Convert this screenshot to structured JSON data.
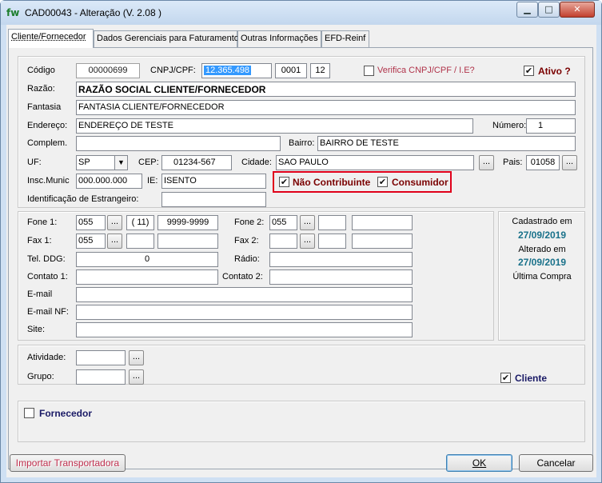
{
  "window": {
    "title": "CAD00043 - Alteração  (V.  2.08 )",
    "icon_text": "fw",
    "min_glyph": "▁",
    "max_glyph": "□",
    "close_glyph": "✕"
  },
  "tabs": [
    {
      "label": "Cliente/Fornecedor"
    },
    {
      "label": "Dados Gerenciais para Faturamento"
    },
    {
      "label": "Outras Informações"
    },
    {
      "label": "EFD-Reinf"
    }
  ],
  "ident": {
    "codigo_label": "Código",
    "codigo_value": "00000699",
    "cnpj_label": "CNPJ/CPF:",
    "cnpj_value": "12.365.498",
    "cnpj_suffix1": "0001",
    "cnpj_suffix2": "12",
    "verifica_label": "Verifica CNPJ/CPF / I.E?",
    "ativo_label": "Ativo ?",
    "razao_label": "Razão:",
    "razao_value": "RAZÃO SOCIAL CLIENTE/FORNECEDOR",
    "fantasia_label": "Fantasia",
    "fantasia_value": "FANTASIA CLIENTE/FORNECEDOR",
    "endereco_label": "Endereço:",
    "endereco_value": "ENDEREÇO DE TESTE",
    "numero_label": "Número:",
    "numero_value": "1",
    "complem_label": "Complem.",
    "complem_value": "",
    "bairro_label": "Bairro:",
    "bairro_value": "BAIRRO DE TESTE",
    "uf_label": "UF:",
    "uf_value": "SP",
    "cep_label": "CEP:",
    "cep_value": "01234-567",
    "cidade_label": "Cidade:",
    "cidade_value": "SAO PAULO",
    "pais_label": "Pais:",
    "pais_value": "01058",
    "insc_label": "Insc.Munic",
    "insc_value": "000.000.000",
    "ie_label": "IE:",
    "ie_value": "ISENTO",
    "nao_contrib_label": "Não Contribuinte",
    "consumidor_label": "Consumidor",
    "estrangeiro_label": "Identificação de Estrangeiro:",
    "estrangeiro_value": ""
  },
  "contact": {
    "fone1_label": "Fone 1:",
    "fone1_ddi": "055",
    "fone1_ddd": "( 11)",
    "fone1_num": "9999-9999",
    "fone2_label": "Fone 2:",
    "fone2_ddi": "055",
    "fax1_label": "Fax 1:",
    "fax1_ddi": "055",
    "fax2_label": "Fax 2:",
    "tel_ddg_label": "Tel. DDG:",
    "tel_ddg_value": "0",
    "radio_label": "Rádio:",
    "contato1_label": "Contato 1:",
    "contato2_label": "Contato 2:",
    "email_label": "E-mail",
    "emailnf_label": "E-mail NF:",
    "site_label": "Site:",
    "dots": "..."
  },
  "status": {
    "cadastrado_label": "Cadastrado em",
    "cadastrado_date": "27/09/2019",
    "alterado_label": "Alterado em",
    "alterado_date": "27/09/2019",
    "ultima_compra_label": "Última Compra"
  },
  "classif": {
    "atividade_label": "Atividade:",
    "grupo_label": "Grupo:",
    "cliente_label": "Cliente"
  },
  "fornecedor": {
    "label": "Fornecedor"
  },
  "footer": {
    "importar_label": "Importar Transportadora",
    "ok_label": "OK",
    "cancelar_label": "Cancelar"
  },
  "checks": {
    "checked_glyph": "✔",
    "verifica": false,
    "ativo": true,
    "nao_contribuinte": true,
    "consumidor": true,
    "cliente": true,
    "fornecedor": false
  },
  "colors": {
    "highlight_border": "#e0001b",
    "dark_red_label": "#7a0000",
    "date_teal": "#19718a",
    "navy_label": "#1a1a66",
    "selection": "#3399ff"
  }
}
